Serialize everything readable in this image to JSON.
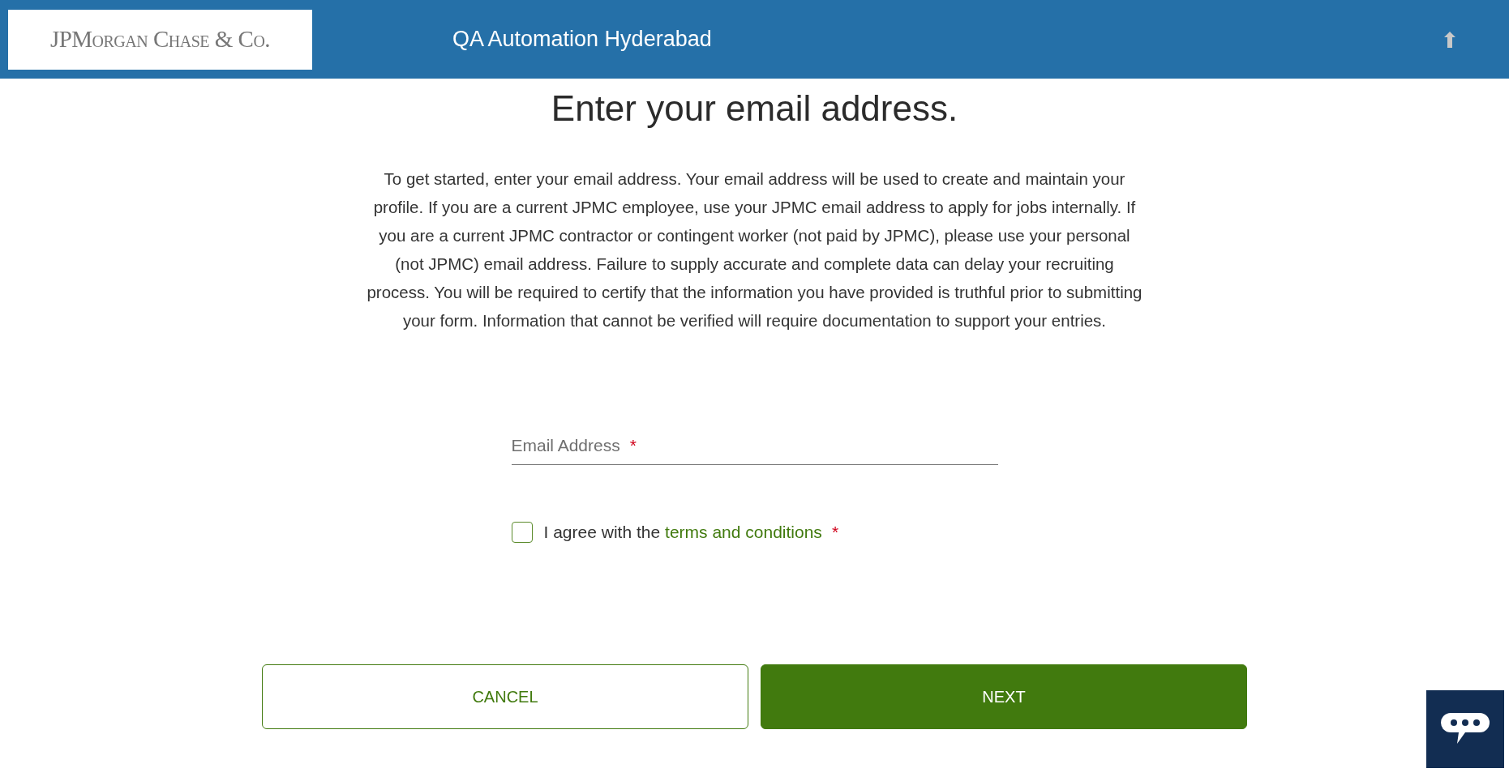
{
  "header": {
    "logo": "JPMorgan Chase & Co.",
    "title": "QA Automation Hyderabad"
  },
  "heading": "Enter your email address.",
  "intro": "To get started, enter your email address. Your email address will be used to create and maintain your profile. If you are a current JPMC employee, use your JPMC email address to apply for jobs internally. If you are a current JPMC contractor or contingent worker (not paid by JPMC), please use your personal (not JPMC) email address. Failure to supply accurate and complete data can delay your recruiting process. You will be required to certify that the information you have provided is truthful prior to submitting your form. Information that cannot be verified will require documentation to support your entries.",
  "email_field": {
    "placeholder": "Email Address",
    "required_mark": "*"
  },
  "agreement": {
    "checked": false,
    "text": "I agree with the",
    "link": "terms and conditions",
    "required_mark": "*"
  },
  "buttons": [
    {
      "kind": "secondary",
      "label": "CANCEL"
    },
    {
      "kind": "primary",
      "label": "NEXT"
    }
  ]
}
